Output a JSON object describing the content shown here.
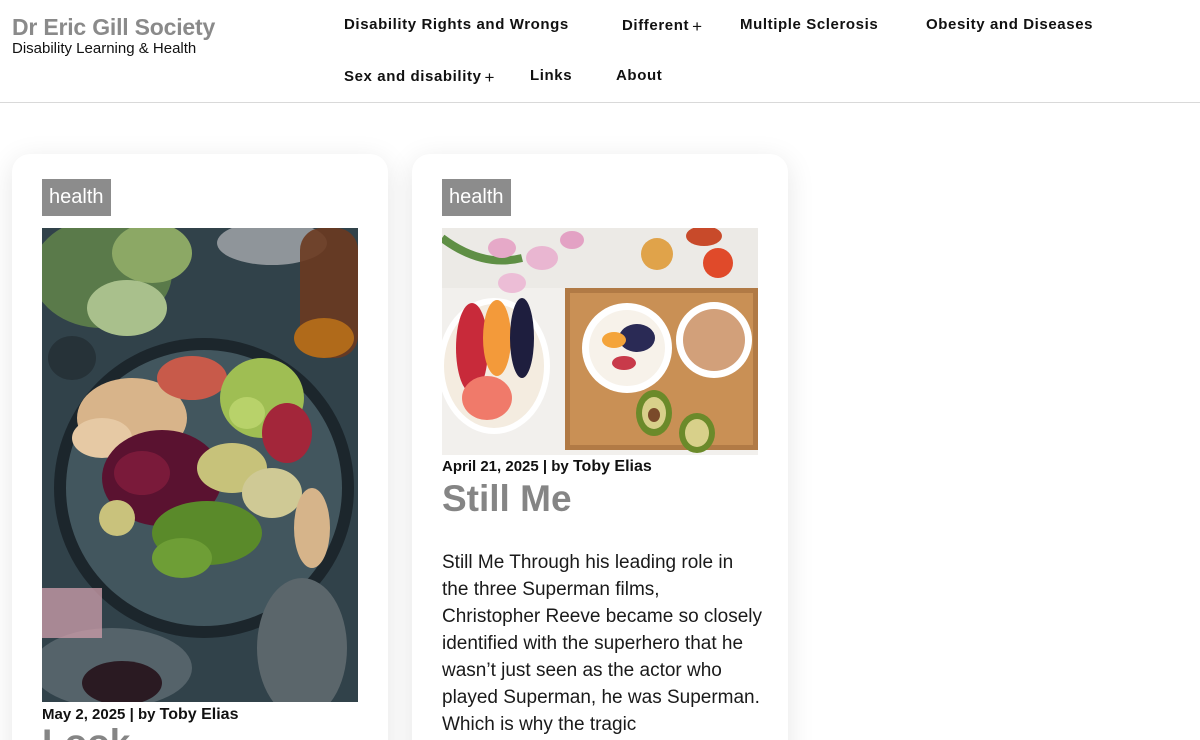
{
  "site": {
    "title": "Dr Eric Gill Society",
    "tagline": "Disability Learning & Health"
  },
  "nav": {
    "items": [
      {
        "label": "Disability Rights and Wrongs",
        "has_submenu": false
      },
      {
        "label": "Different",
        "has_submenu": true
      },
      {
        "label": "Multiple Sclerosis",
        "has_submenu": false
      },
      {
        "label": "Obesity and Diseases",
        "has_submenu": false
      },
      {
        "label": "Sex and disability",
        "has_submenu": true
      },
      {
        "label": "Links",
        "has_submenu": false
      },
      {
        "label": "About",
        "has_submenu": false
      }
    ],
    "submenu_glyph": "+"
  },
  "posts": [
    {
      "category": "health",
      "date": "May 2, 2025",
      "by": "| by",
      "author": "Toby Elias",
      "title": "Look...",
      "image_icon": "food-platter-photo"
    },
    {
      "category": "health",
      "date": "April 21, 2025",
      "by": "| by",
      "author": "Toby Elias",
      "title": "Still Me",
      "excerpt": "Still Me Through his leading role in the three Superman films, Christopher Reeve became so closely identified with the superhero that he wasn’t just seen as the actor who played Superman, he was Superman. Which is why the tragic",
      "image_icon": "breakfast-table-photo"
    }
  ],
  "colors": {
    "brand": "#8a8a8a",
    "tag_bg": "#8c8c8c",
    "title": "#858585"
  }
}
